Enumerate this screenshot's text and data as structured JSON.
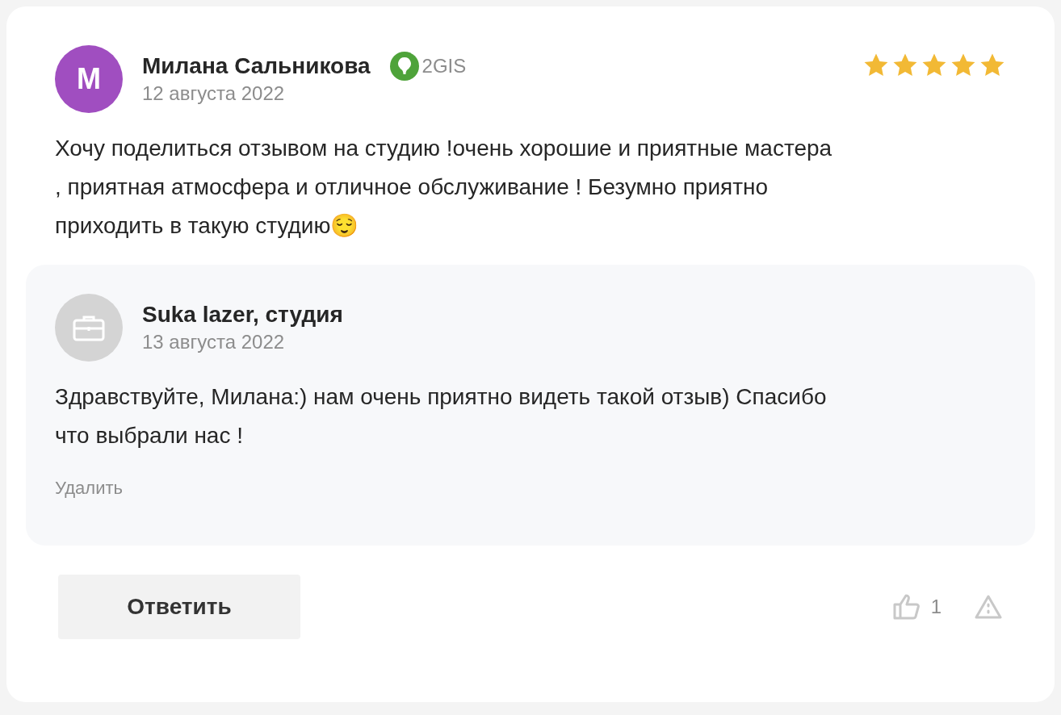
{
  "review": {
    "avatar_letter": "М",
    "author": "Милана Сальникова",
    "source": "2GIS",
    "date": "12 августа 2022",
    "stars": 5,
    "text": "Хочу поделиться отзывом на студию !очень хорошие и приятные мастера , приятная атмосфера и отличное обслуживание ! Безумно приятно приходить в такую студию😌"
  },
  "reply": {
    "author": "Suka lazer, студия",
    "date": "13 августа 2022",
    "text": "Здравствуйте, Милана:) нам очень приятно видеть такой отзыв) Спасибо что выбрали нас !",
    "delete_label": "Удалить"
  },
  "footer": {
    "reply_button": "Ответить",
    "likes": "1"
  }
}
